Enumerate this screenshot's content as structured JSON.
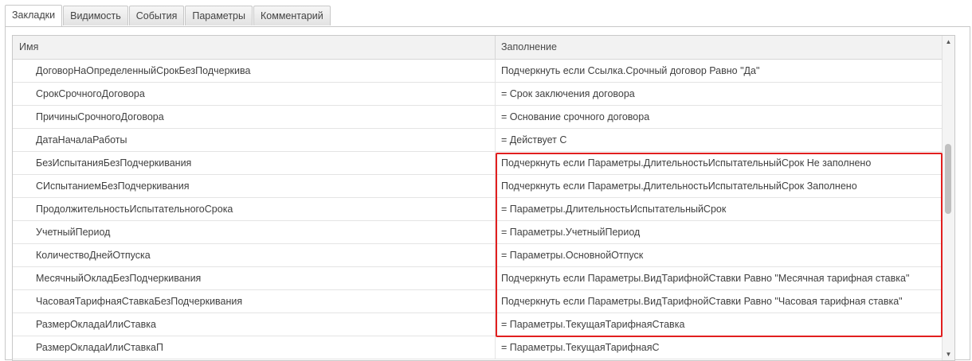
{
  "tabs": [
    "Закладки",
    "Видимость",
    "События",
    "Параметры",
    "Комментарий"
  ],
  "active_tab": "Закладки",
  "grid": {
    "columns": [
      "Имя",
      "Заполнение"
    ],
    "rows": [
      {
        "name": "ДоговорНаОпределенныйСрокБезПодчеркива",
        "fill": "Подчеркнуть если Ссылка.Срочный договор Равно \"Да\""
      },
      {
        "name": "СрокСрочногоДоговора",
        "fill": "= Срок заключения договора"
      },
      {
        "name": "ПричиныСрочногоДоговора",
        "fill": "= Основание срочного договора"
      },
      {
        "name": "ДатаНачалаРаботы",
        "fill": "= Действует С"
      },
      {
        "name": "БезИспытанияБезПодчеркивания",
        "fill": "Подчеркнуть если Параметры.ДлительностьИспытательныйСрок Не заполнено"
      },
      {
        "name": "СИспытаниемБезПодчеркивания",
        "fill": "Подчеркнуть если Параметры.ДлительностьИспытательныйСрок Заполнено"
      },
      {
        "name": "ПродолжительностьИспытательногоСрока",
        "fill": "= Параметры.ДлительностьИспытательныйСрок"
      },
      {
        "name": "УчетныйПериод",
        "fill": "= Параметры.УчетныйПериод"
      },
      {
        "name": "КоличествоДнейОтпуска",
        "fill": "= Параметры.ОсновнойОтпуск"
      },
      {
        "name": "МесячныйОкладБезПодчеркивания",
        "fill": "Подчеркнуть если Параметры.ВидТарифнойСтавки Равно \"Месячная тарифная ставка\""
      },
      {
        "name": "ЧасоваяТарифнаяСтавкаБезПодчеркивания",
        "fill": "Подчеркнуть если Параметры.ВидТарифнойСтавки Равно \"Часовая тарифная ставка\""
      },
      {
        "name": "РазмерОкладаИлиСтавка",
        "fill": "= Параметры.ТекущаяТарифнаяСтавка"
      },
      {
        "name": "РазмерОкладаИлиСтавкаП",
        "fill": "= Параметры.ТекущаяТарифнаяС"
      }
    ]
  },
  "highlight_color": "#e11f1f",
  "icons": {
    "scroll_up": "▲",
    "scroll_down": "▼"
  }
}
